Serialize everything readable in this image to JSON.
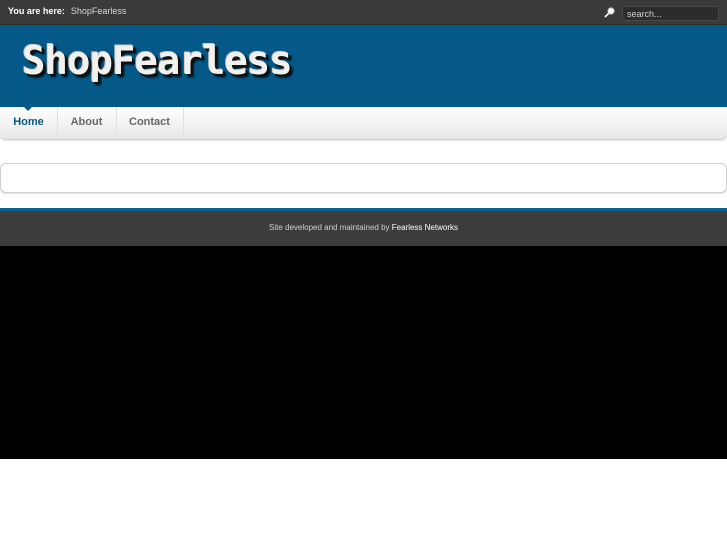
{
  "topbar": {
    "breadcrumb_label": "You are here:",
    "breadcrumb_current": "ShopFearless",
    "search_placeholder": "search..."
  },
  "header": {
    "logo_text": "ShopFearless"
  },
  "nav": {
    "items": [
      {
        "label": "Home",
        "active": true
      },
      {
        "label": "About",
        "active": false
      },
      {
        "label": "Contact",
        "active": false
      }
    ]
  },
  "footer": {
    "text": "Site developed and maintained by",
    "link_text": "Fearless Networks"
  },
  "colors": {
    "brand_blue": "#055988",
    "topbar_bg": "#3a3a3a",
    "footer_bg": "#3c3c3c",
    "black_area": "#000000"
  }
}
